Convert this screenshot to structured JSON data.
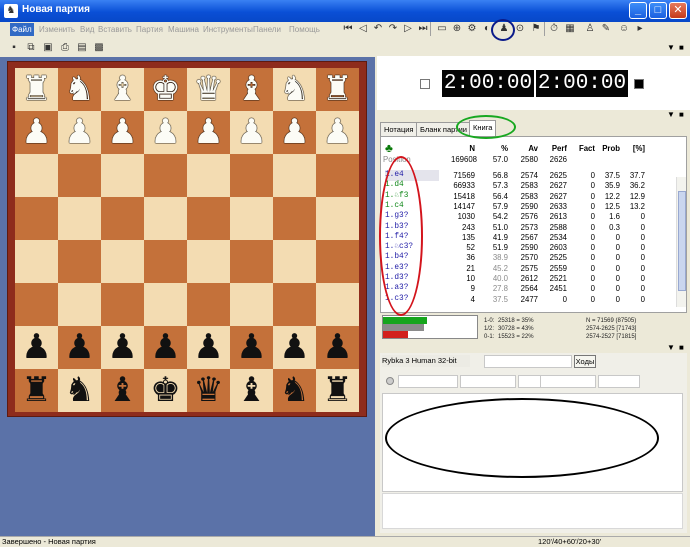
{
  "window": {
    "title": "Новая партия",
    "app_icon": "app-icon"
  },
  "menu": [
    {
      "label": "Файл",
      "active": true
    },
    {
      "label": "Изменить"
    },
    {
      "label": "Вид"
    },
    {
      "label": "Вставить"
    },
    {
      "label": "Партия"
    },
    {
      "label": "Машина"
    },
    {
      "label": "Инструменты"
    },
    {
      "label": "Панели"
    },
    {
      "label": "Помощь"
    }
  ],
  "toolbar_left_icons": [
    "save-icon",
    "copy-board-icon",
    "screenshot-icon",
    "print-icon",
    "print-diagram-icon",
    "image-icon"
  ],
  "toolbar_right_icons": [
    "first-move-icon",
    "back-icon",
    "back-one-icon",
    "forward-one-icon",
    "forward-icon",
    "last-move-icon",
    "new-game-icon",
    "analysis-icon",
    "engine-icon",
    "flip-board-icon",
    "piece-icon",
    "lookup-icon",
    "flag-icon",
    "timer-icon",
    "board-icon",
    "book-icon",
    "kibitz-icon",
    "human-icon",
    "more-icon"
  ],
  "board": {
    "ranks": [
      [
        "r",
        "n",
        "b",
        "k",
        "q",
        "b",
        "n",
        "r"
      ],
      [
        "p",
        "p",
        "p",
        "p",
        "p",
        "p",
        "p",
        "p"
      ],
      [
        "",
        "",
        "",
        "",
        "",
        "",
        "",
        ""
      ],
      [
        "",
        "",
        "",
        "",
        "",
        "",
        "",
        ""
      ],
      [
        "",
        "",
        "",
        "",
        "",
        "",
        "",
        ""
      ],
      [
        "",
        "",
        "",
        "",
        "",
        "",
        "",
        ""
      ],
      [
        "P",
        "P",
        "P",
        "P",
        "P",
        "P",
        "P",
        "P"
      ],
      [
        "R",
        "N",
        "B",
        "K",
        "Q",
        "B",
        "N",
        "R"
      ]
    ],
    "white_on_top": true
  },
  "clocks": {
    "white": "2:00:00",
    "black": "2:00:00"
  },
  "tabs": [
    {
      "label": "Нотация"
    },
    {
      "label": "Бланк партии"
    },
    {
      "label": "Книга",
      "active": true
    }
  ],
  "book": {
    "headers": {
      "n": "N",
      "pct": "%",
      "av": "Av",
      "perf": "Perf",
      "fact": "Fact",
      "prob": "Prob",
      "bpct": "[%]"
    },
    "root": {
      "label": "Position",
      "n": "169608",
      "pct": "57.0",
      "av": "2580",
      "perf": "2626",
      "fact": "",
      "prob": "",
      "bpct": ""
    },
    "rows": [
      {
        "move": "1.e4",
        "n": "71569",
        "pct": "56.8",
        "av": "2574",
        "perf": "2625",
        "fact": "0",
        "prob": "37.5",
        "bpct": "37.7",
        "color": "blue",
        "selected": true
      },
      {
        "move": "1.d4",
        "n": "66933",
        "pct": "57.3",
        "av": "2583",
        "perf": "2627",
        "fact": "0",
        "prob": "35.9",
        "bpct": "36.2",
        "color": "green"
      },
      {
        "move": "1.♘f3",
        "n": "15418",
        "pct": "56.4",
        "av": "2583",
        "perf": "2627",
        "fact": "0",
        "prob": "12.2",
        "bpct": "12.9",
        "color": "green"
      },
      {
        "move": "1.c4",
        "n": "14147",
        "pct": "57.9",
        "av": "2590",
        "perf": "2633",
        "fact": "0",
        "prob": "12.5",
        "bpct": "13.2",
        "color": "green"
      },
      {
        "move": "1.g3?",
        "n": "1030",
        "pct": "54.2",
        "av": "2576",
        "perf": "2613",
        "fact": "0",
        "prob": "1.6",
        "bpct": "0",
        "color": "blue"
      },
      {
        "move": "1.b3?",
        "n": "243",
        "pct": "51.0",
        "av": "2573",
        "perf": "2588",
        "fact": "0",
        "prob": "0.3",
        "bpct": "0",
        "color": "blue"
      },
      {
        "move": "1.f4?",
        "n": "135",
        "pct": "41.9",
        "av": "2567",
        "perf": "2534",
        "fact": "0",
        "prob": "0",
        "bpct": "0",
        "color": "blue"
      },
      {
        "move": "1.♘c3?",
        "n": "52",
        "pct": "51.9",
        "av": "2590",
        "perf": "2603",
        "fact": "0",
        "prob": "0",
        "bpct": "0",
        "color": "blue"
      },
      {
        "move": "1.b4?",
        "n": "36",
        "pct": "38.9",
        "av": "2570",
        "perf": "2525",
        "fact": "0",
        "prob": "0",
        "bpct": "0",
        "color": "blue",
        "gray_pct": true
      },
      {
        "move": "1.e3?",
        "n": "21",
        "pct": "45.2",
        "av": "2575",
        "perf": "2559",
        "fact": "0",
        "prob": "0",
        "bpct": "0",
        "color": "blue",
        "gray_pct": true
      },
      {
        "move": "1.d3?",
        "n": "10",
        "pct": "40.0",
        "av": "2612",
        "perf": "2521",
        "fact": "0",
        "prob": "0",
        "bpct": "0",
        "color": "blue",
        "gray_pct": true
      },
      {
        "move": "1.a3?",
        "n": "9",
        "pct": "27.8",
        "av": "2564",
        "perf": "2451",
        "fact": "0",
        "prob": "0",
        "bpct": "0",
        "color": "blue",
        "gray_pct": true
      },
      {
        "move": "1.c3?",
        "n": "4",
        "pct": "37.5",
        "av": "2477",
        "perf": "0",
        "fact": "0",
        "prob": "0",
        "bpct": "0",
        "color": "blue",
        "gray_pct": true
      }
    ]
  },
  "stats": {
    "win": 0.35,
    "draw": 0.43,
    "loss": 0.22,
    "lines": [
      [
        "1-0:",
        "25318 = 35%",
        "N = 71569 (87505)"
      ],
      [
        "1/2:",
        "30728 = 43%",
        "2574-2625 [71743]"
      ],
      [
        "0-1:",
        "15523 = 22%",
        "2574-2527 [71815]"
      ]
    ]
  },
  "engine": {
    "name": "Rybka 3 Human 32-bit",
    "moves_label": "Ходы"
  },
  "status": {
    "left": "Завершено - Новая партия",
    "right": "120'/40+60'/20+30'"
  },
  "highlight_colors": {
    "red": "#d3141c",
    "green": "#18a820",
    "navy": "#0b1b8a",
    "black": "#000000"
  }
}
